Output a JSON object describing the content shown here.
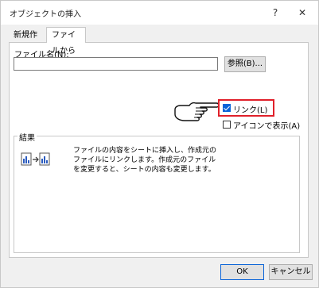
{
  "window": {
    "title": "オブジェクトの挿入",
    "help_label": "?",
    "close_label": "✕"
  },
  "tabs": [
    {
      "label": "新規作成"
    },
    {
      "label": "ファイルから"
    }
  ],
  "file": {
    "label": "ファイル名(N):",
    "value": "",
    "browse_label": "参照(B)..."
  },
  "options": {
    "link_label": "リンク(L)",
    "link_checked": true,
    "icon_label": "アイコンで表示(A)",
    "icon_checked": false
  },
  "result": {
    "title": "結果",
    "text": "ファイルの内容をシートに挿入し、作成元のファイルにリンクします。作成元のファイルを変更すると、シートの内容も変更します。"
  },
  "footer": {
    "ok_label": "OK",
    "cancel_label": "キャンセル"
  },
  "colors": {
    "highlight": "#e0202a",
    "accent": "#0a64d8"
  }
}
